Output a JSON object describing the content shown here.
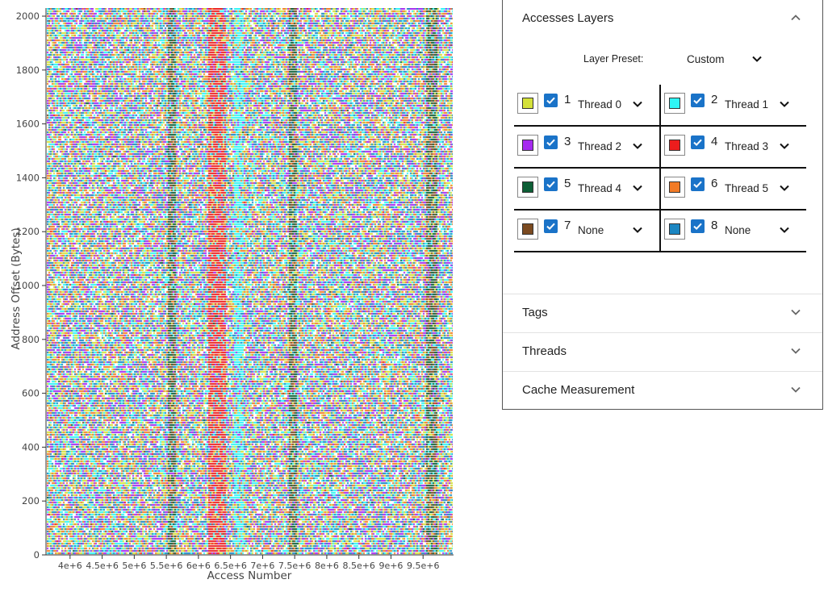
{
  "chart_data": {
    "type": "scatter",
    "xlabel": "Access Number",
    "ylabel": "Address Offset (Bytes)",
    "xlim": [
      3625000,
      9975000
    ],
    "ylim": [
      0,
      2030
    ],
    "x_ticks": [
      4000000,
      4500000,
      5000000,
      5500000,
      6000000,
      6500000,
      7000000,
      7500000,
      8000000,
      8500000,
      9000000,
      9500000
    ],
    "x_tick_labels": [
      "4e+6",
      "4.5e+6",
      "5e+6",
      "5.5e+6",
      "6e+6",
      "6.5e+6",
      "7e+6",
      "7.5e+6",
      "8e+6",
      "8.5e+6",
      "9e+6",
      "9.5e+6"
    ],
    "y_ticks": [
      0,
      200,
      400,
      600,
      800,
      1000,
      1200,
      1400,
      1600,
      1800,
      2000
    ],
    "y_tick_labels": [
      "0",
      "200",
      "400",
      "600",
      "800",
      "1000",
      "1200",
      "1400",
      "1600",
      "1800",
      "2000"
    ],
    "series": [
      {
        "name": "Thread 0",
        "color": "#d4e13a"
      },
      {
        "name": "Thread 1",
        "color": "#2ff5f5"
      },
      {
        "name": "Thread 2",
        "color": "#a62af0"
      },
      {
        "name": "Thread 3",
        "color": "#ec1d1d"
      },
      {
        "name": "Thread 4",
        "color": "#0c5e35"
      },
      {
        "name": "Thread 5",
        "color": "#f27b26"
      },
      {
        "name": "None",
        "color": "#7b4a20"
      },
      {
        "name": "None",
        "color": "#1b86c2"
      }
    ],
    "grid": false,
    "legend": "none"
  },
  "panel": {
    "sections": [
      {
        "title": "Accesses Layers",
        "expanded": true,
        "chevron": "chevron-up-icon"
      },
      {
        "title": "Tags",
        "expanded": false,
        "chevron": "chevron-down-icon"
      },
      {
        "title": "Threads",
        "expanded": false,
        "chevron": "chevron-down-icon"
      },
      {
        "title": "Cache Measurement",
        "expanded": false,
        "chevron": "chevron-down-icon"
      }
    ],
    "preset": {
      "label": "Layer Preset:",
      "value": "Custom"
    },
    "layers": [
      {
        "num": "1",
        "selection": "Thread 0",
        "color": "#d4e13a",
        "checked": true
      },
      {
        "num": "2",
        "selection": "Thread 1",
        "color": "#2ff5f5",
        "checked": true
      },
      {
        "num": "3",
        "selection": "Thread 2",
        "color": "#a62af0",
        "checked": true
      },
      {
        "num": "4",
        "selection": "Thread 3",
        "color": "#ec1d1d",
        "checked": true
      },
      {
        "num": "5",
        "selection": "Thread 4",
        "color": "#0c5e35",
        "checked": true
      },
      {
        "num": "6",
        "selection": "Thread 5",
        "color": "#f27b26",
        "checked": true
      },
      {
        "num": "7",
        "selection": "None",
        "color": "#7b4a20",
        "checked": true
      },
      {
        "num": "8",
        "selection": "None",
        "color": "#1b86c2",
        "checked": true
      }
    ]
  }
}
